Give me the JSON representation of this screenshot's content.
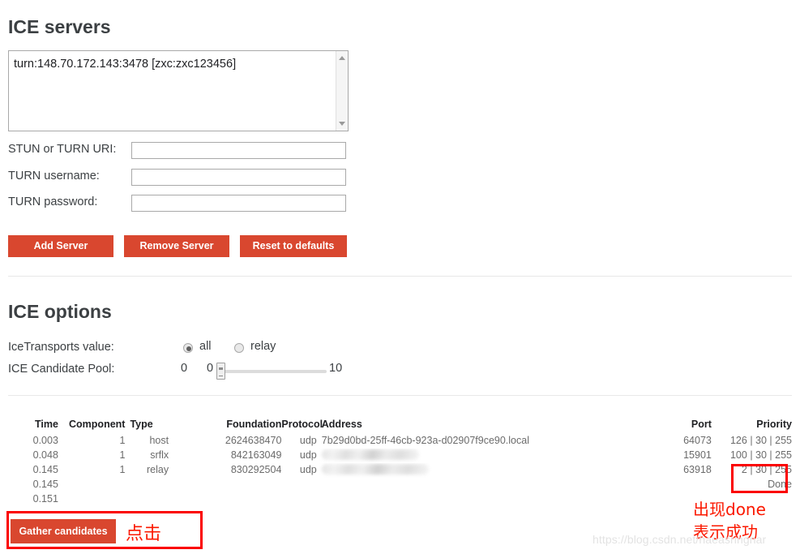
{
  "ice_servers": {
    "title": "ICE servers",
    "servers_textarea_value": "turn:148.70.172.143:3478 [zxc:zxc123456]",
    "fields": [
      {
        "label": "STUN or TURN URI:",
        "value": "",
        "placeholder": ""
      },
      {
        "label": "TURN username:",
        "value": "",
        "placeholder": ""
      },
      {
        "label": "TURN password:",
        "value": "",
        "placeholder": ""
      }
    ],
    "buttons": {
      "add": "Add Server",
      "remove": "Remove Server",
      "reset": "Reset to defaults"
    }
  },
  "ice_options": {
    "title": "ICE options",
    "transports": {
      "label": "IceTransports value:",
      "options": [
        {
          "label": "all",
          "selected": true
        },
        {
          "label": "relay",
          "selected": false
        }
      ]
    },
    "candidate_pool": {
      "label": "ICE Candidate Pool:",
      "min": "0",
      "value": "0",
      "max": "10"
    }
  },
  "candidates": {
    "columns": [
      "Time",
      "Component",
      "Type",
      "Foundation",
      "Protocol",
      "Address",
      "Port",
      "Priority"
    ],
    "rows": [
      {
        "time": "0.003",
        "component": "1",
        "type": "host",
        "foundation": "2624638470",
        "protocol": "udp",
        "address": "7b29d0bd-25ff-46cb-923a-d02907f9ce90.local",
        "address_redacted": false,
        "port": "64073",
        "priority": "126 | 30 | 255"
      },
      {
        "time": "0.048",
        "component": "1",
        "type": "srflx",
        "foundation": "842163049",
        "protocol": "udp",
        "address": "",
        "address_redacted": true,
        "port": "15901",
        "priority": "100 | 30 | 255"
      },
      {
        "time": "0.145",
        "component": "1",
        "type": "relay",
        "foundation": "830292504",
        "protocol": "udp",
        "address": "",
        "address_redacted": true,
        "port": "63918",
        "priority": "2 | 30 | 255"
      },
      {
        "time": "0.145",
        "component": "",
        "type": "",
        "foundation": "",
        "protocol": "",
        "address": "",
        "address_redacted": false,
        "port": "",
        "priority": "Done"
      },
      {
        "time": "0.151",
        "component": "",
        "type": "",
        "foundation": "",
        "protocol": "",
        "address": "",
        "address_redacted": false,
        "port": "",
        "priority": ""
      }
    ]
  },
  "gather": {
    "button_label": "Gather candidates"
  },
  "annotations": {
    "click_text": "点击",
    "done_line1": "出现done",
    "done_line2": "表示成功",
    "box_color": "#fb0000"
  },
  "watermark": {
    "text": "https://blog.csdn.net/haeasringnar"
  }
}
